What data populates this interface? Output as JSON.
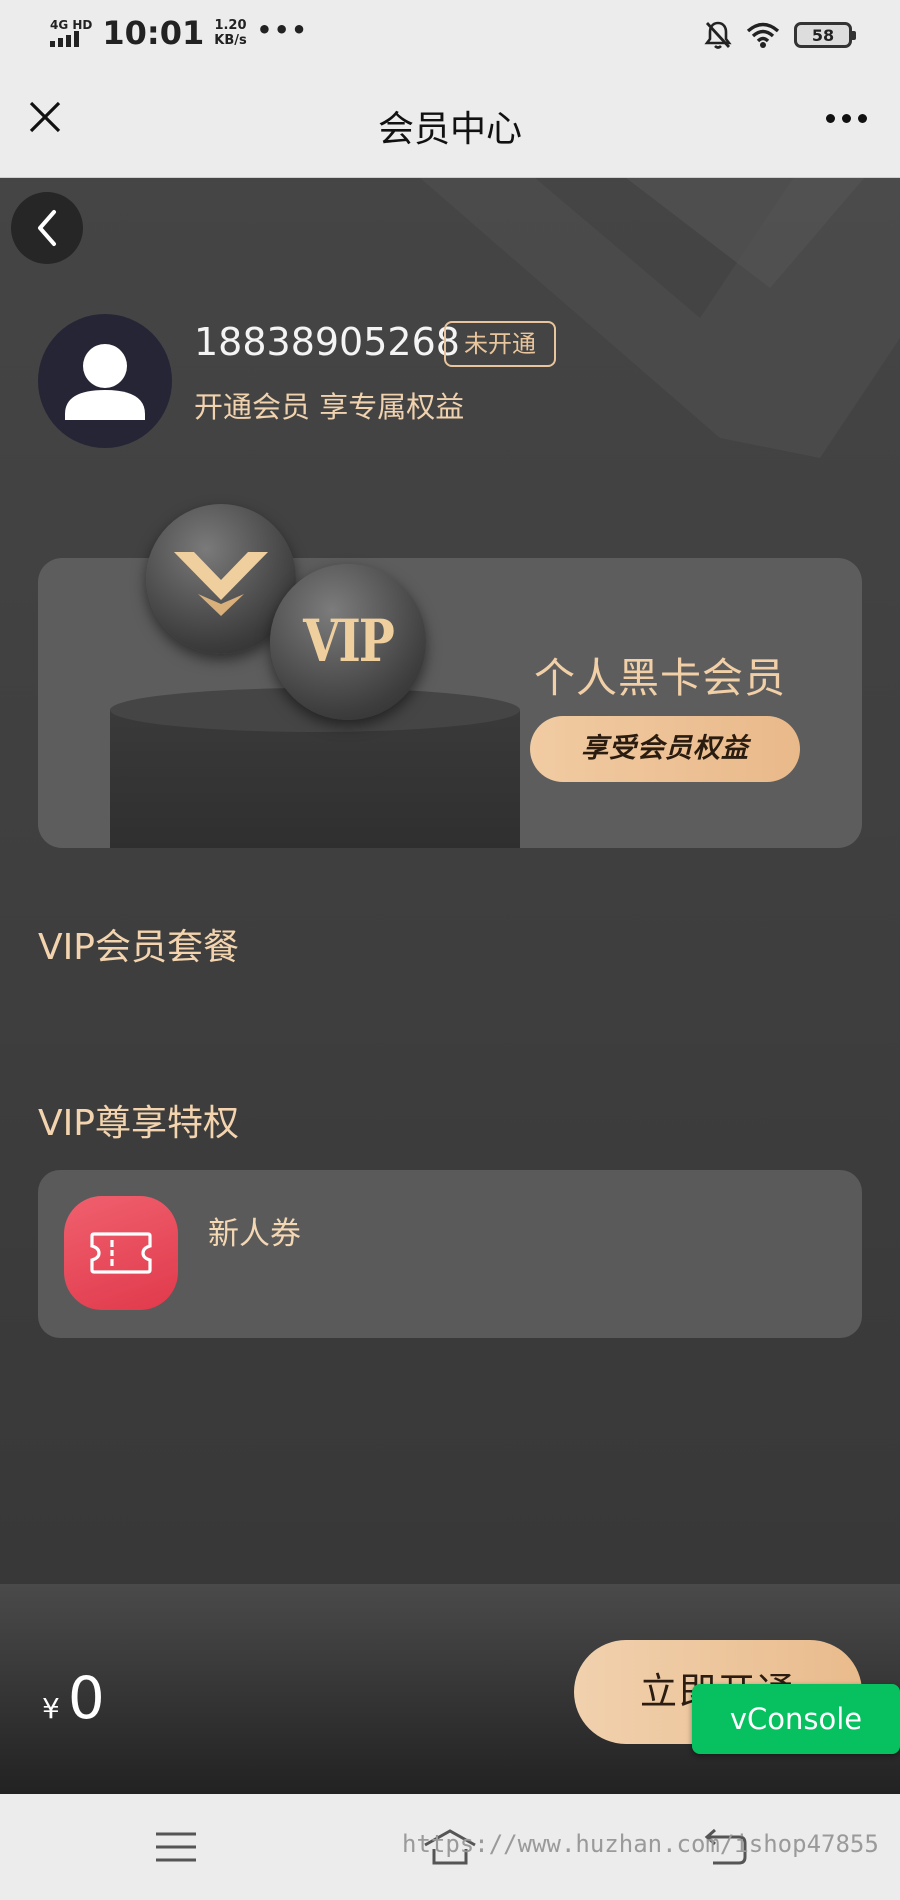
{
  "status_bar": {
    "network": "4G HD",
    "time": "10:01",
    "speed_value": "1.20",
    "speed_unit": "KB/s",
    "more": "•••",
    "battery": "58"
  },
  "header": {
    "title": "会员中心"
  },
  "profile": {
    "phone": "18838905268",
    "status_badge": "未开通",
    "subtitle": "开通会员 享专属权益"
  },
  "vip_card": {
    "coin_label": "VIP",
    "title": "个人黑卡会员",
    "button_label": "享受会员权益"
  },
  "sections": {
    "packages_title": "VIP会员套餐",
    "privileges_title": "VIP尊享特权"
  },
  "privileges": [
    {
      "label": "新人券",
      "icon": "ticket-icon"
    }
  ],
  "pay_bar": {
    "currency": "¥",
    "amount": "0",
    "open_button": "立即开通"
  },
  "vconsole": {
    "label": "vConsole"
  },
  "watermark": "https://www.huzhan.com/ishop47855",
  "colors": {
    "accent_gold": "#f1cfa7",
    "vconsole_green": "#07c160",
    "privilege_icon_red": "#e9475a"
  }
}
